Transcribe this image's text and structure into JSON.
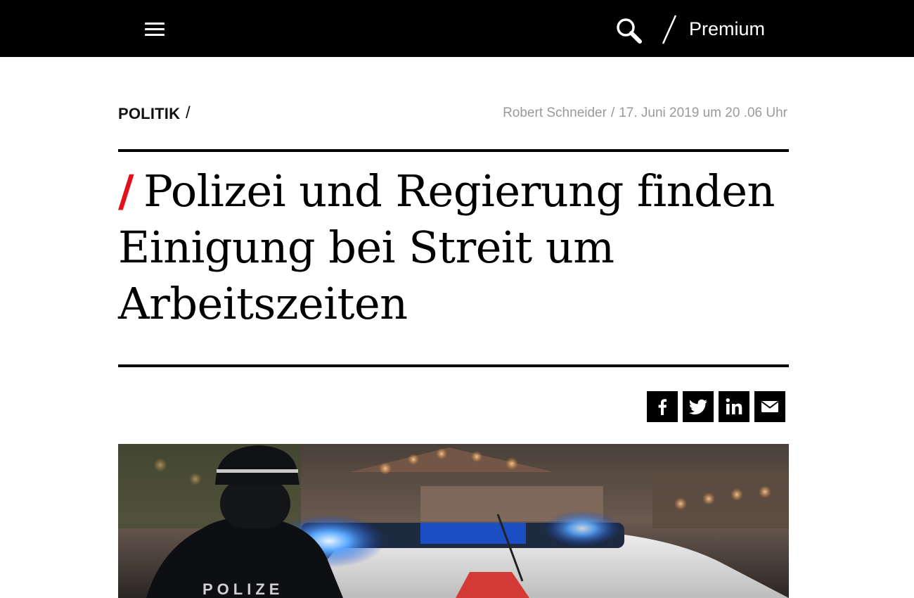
{
  "header": {
    "menu_icon": "hamburger-menu-icon",
    "search_icon": "search-icon",
    "premium_label": "Premium"
  },
  "article": {
    "category": "POLITIK",
    "category_separator": "/",
    "author": "Robert Schneider",
    "meta_separator": "/",
    "date": "17. Juni 2019 um 20 .06 Uhr",
    "headline_accent": "/",
    "headline": "Polizei und Regierung finden Einigung bei Streit um Arbeitszeiten"
  },
  "share": {
    "facebook_icon": "facebook-icon",
    "twitter_icon": "twitter-icon",
    "linkedin_icon": "linkedin-icon",
    "email_icon": "email-icon"
  },
  "colors": {
    "topbar": "#000000",
    "accent": "#e2101a",
    "meta_text": "#9a9a9a"
  }
}
